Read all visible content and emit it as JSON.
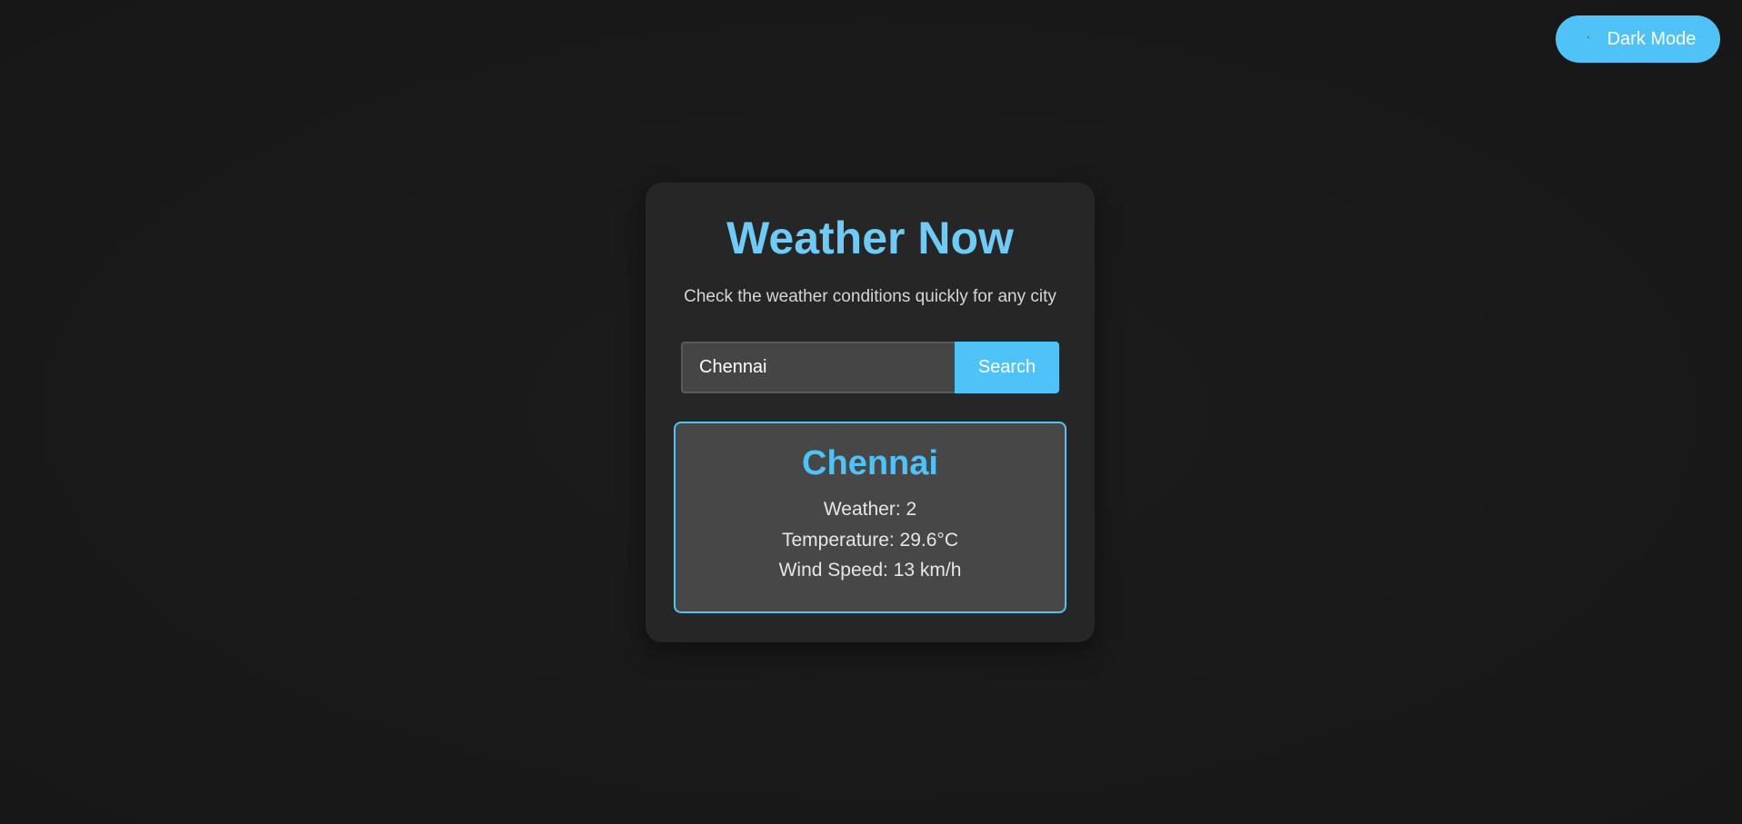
{
  "header": {
    "theme_toggle": {
      "icon": "moon-icon",
      "label": "Dark Mode"
    }
  },
  "app": {
    "title": "Weather Now",
    "subtitle": "Check the weather conditions quickly for any city"
  },
  "search": {
    "value": "Chennai",
    "button_label": "Search"
  },
  "result": {
    "city": "Chennai",
    "weather": "Weather: 2",
    "temperature": "Temperature: 29.6°C",
    "wind_speed": "Wind Speed: 13 km/h"
  },
  "colors": {
    "accent": "#4fc3f7",
    "background": "#191919",
    "card": "#262626",
    "result_box": "#474747"
  }
}
